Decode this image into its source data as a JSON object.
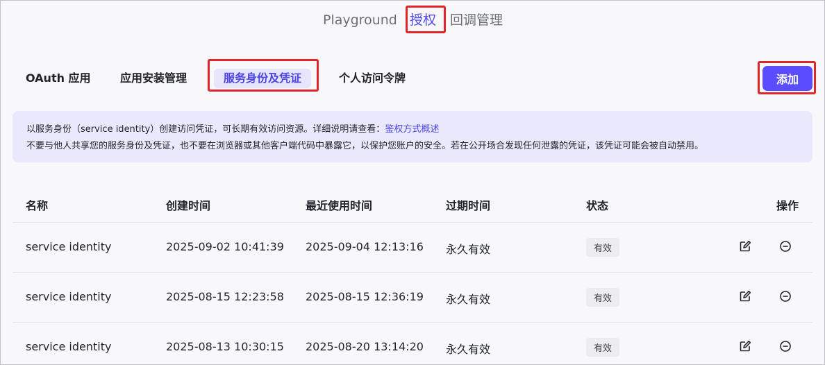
{
  "topnav": {
    "items": [
      {
        "label": "Playground"
      },
      {
        "label": "授权"
      },
      {
        "label": "回调管理"
      }
    ]
  },
  "subtabs": [
    {
      "label": "OAuth 应用"
    },
    {
      "label": "应用安装管理"
    },
    {
      "label": "服务身份及凭证"
    },
    {
      "label": "个人访问令牌"
    }
  ],
  "add_label": "添加",
  "notice": {
    "line1_prefix": "以服务身份（service identity）创建访问凭证，可长期有效访问资源。详细说明请查看：",
    "line1_link": "鉴权方式概述",
    "line2": "不要与他人共享您的服务身份及凭证，也不要在浏览器或其他客户端代码中暴露它，以保护您账户的安全。若在公开场合发现任何泄露的凭证，该凭证可能会被自动禁用。"
  },
  "table": {
    "headers": [
      "名称",
      "创建时间",
      "最近使用时间",
      "过期时间",
      "状态",
      "操作"
    ],
    "rows": [
      {
        "name": "service identity",
        "created": "2025-09-02 10:41:39",
        "last_used": "2025-09-04 12:13:16",
        "expires": "永久有效",
        "status": "有效"
      },
      {
        "name": "service identity",
        "created": "2025-08-15 12:23:58",
        "last_used": "2025-08-15 12:36:19",
        "expires": "永久有效",
        "status": "有效"
      },
      {
        "name": "service identity",
        "created": "2025-08-13 10:30:15",
        "last_used": "2025-08-20 13:14:20",
        "expires": "永久有效",
        "status": "有效"
      }
    ]
  },
  "colors": {
    "accent": "#5a4dff",
    "highlight": "#e0262a",
    "notice_bg": "#e9e8fc"
  },
  "icons": [
    "edit-icon",
    "remove-circle-icon"
  ]
}
